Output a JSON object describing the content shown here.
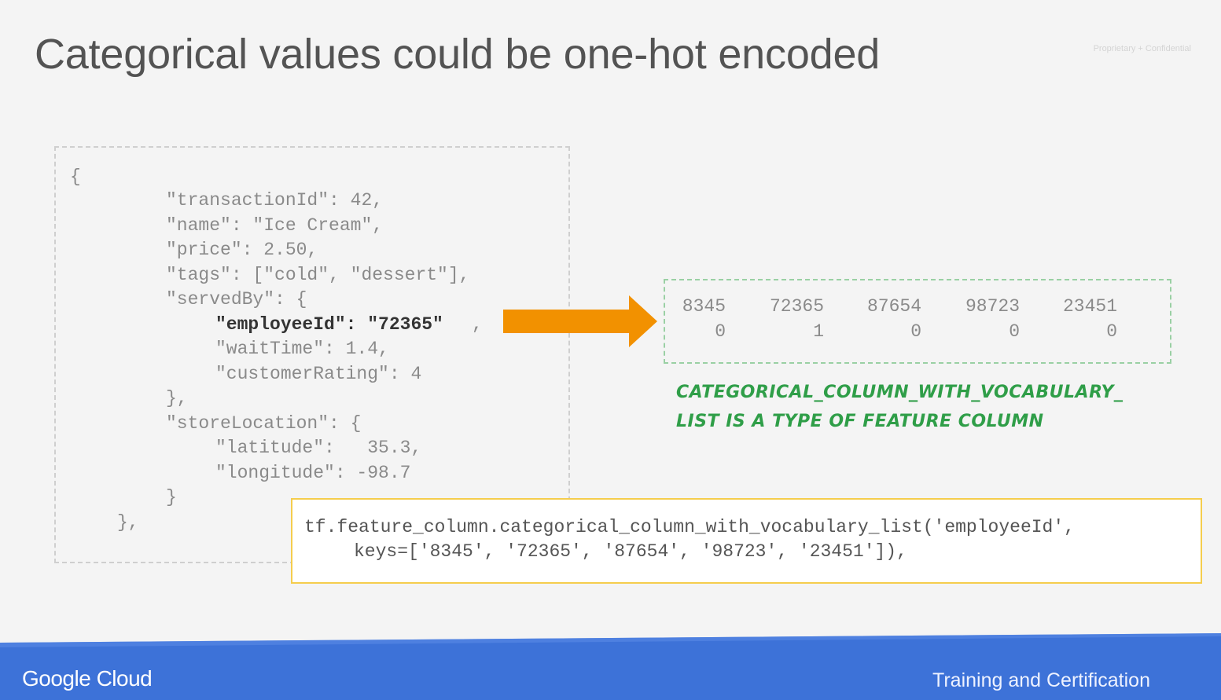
{
  "slide": {
    "title": "Categorical values could be one-hot encoded",
    "confidential": "Proprietary + Confidential"
  },
  "json_lines": [
    "{",
    "\"transactionId\": 42,",
    "\"name\": \"Ice Cream\",",
    "\"price\": 2.50,",
    "\"tags\": [\"cold\", \"dessert\"],",
    "\"servedBy\": {",
    "\"employeeId\": \"72365\"",
    ",",
    "\"waitTime\": 1.4,",
    "\"customerRating\": 4",
    "},",
    "\"storeLocation\": {",
    "\"latitude\":   35.3,",
    "\"longitude\": -98.7",
    "}",
    "},"
  ],
  "vocabulary": {
    "keys": [
      "8345",
      "72365",
      "87654",
      "98723",
      "23451"
    ],
    "encoding": [
      "0",
      "1",
      "0",
      "0",
      "0"
    ]
  },
  "annotation": {
    "line1": "CATEGORICAL_COLUMN_WITH_VOCABULARY_",
    "line2": "LIST IS A TYPE OF FEATURE COLUMN"
  },
  "code": {
    "line1": "tf.feature_column.categorical_column_with_vocabulary_list('employeeId',",
    "line2": "keys=['8345', '72365', '87654', '98723', '23451']),"
  },
  "footer": {
    "logo": "Google Cloud",
    "right_text": "Training and Certification"
  },
  "colors": {
    "arrow": "#f29100",
    "footer_blue": "#3d72d8",
    "annotation_green": "#2f9e48",
    "code_box_border": "#f5cd4d"
  }
}
